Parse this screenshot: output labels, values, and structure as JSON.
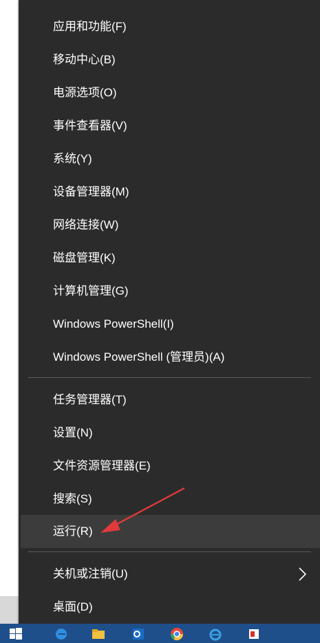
{
  "menu": {
    "groups": [
      {
        "items": [
          {
            "label": "应用和功能(F)"
          },
          {
            "label": "移动中心(B)"
          },
          {
            "label": "电源选项(O)"
          },
          {
            "label": "事件查看器(V)"
          },
          {
            "label": "系统(Y)"
          },
          {
            "label": "设备管理器(M)"
          },
          {
            "label": "网络连接(W)"
          },
          {
            "label": "磁盘管理(K)"
          },
          {
            "label": "计算机管理(G)"
          },
          {
            "label": "Windows PowerShell(I)"
          },
          {
            "label": "Windows PowerShell (管理员)(A)"
          }
        ]
      },
      {
        "items": [
          {
            "label": "任务管理器(T)"
          },
          {
            "label": "设置(N)"
          },
          {
            "label": "文件资源管理器(E)"
          },
          {
            "label": "搜索(S)"
          },
          {
            "label": "运行(R)",
            "highlighted": true
          }
        ]
      },
      {
        "items": [
          {
            "label": "关机或注销(U)",
            "has_submenu": true
          },
          {
            "label": "桌面(D)"
          }
        ]
      }
    ]
  },
  "colors": {
    "menu_background": "#2b2b2b",
    "hover_background": "#3c3c3c",
    "text": "#ffffff",
    "annotation_arrow": "#e03a3a",
    "taskbar": "#1f4f8a"
  },
  "icons": [
    "chevron-right-icon",
    "windows-start-icon",
    "edge-icon",
    "file-explorer-icon",
    "outlook-icon",
    "chrome-icon",
    "ie-icon"
  ]
}
